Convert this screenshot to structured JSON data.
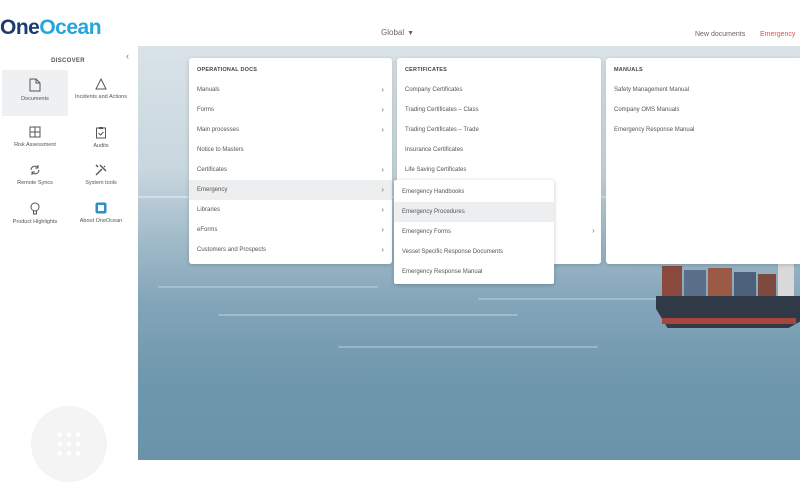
{
  "header": {
    "logo_one": "One",
    "logo_ocean": "Ocean",
    "region_selector": "Global",
    "new_documents": "New documents",
    "emergency": "Emergency"
  },
  "sidebar": {
    "title": "DISCOVER",
    "items": [
      {
        "label": "Documents",
        "icon": "document-icon",
        "active": true
      },
      {
        "label": "Incidents and Actions",
        "icon": "warning-icon"
      },
      {
        "label": "Risk Assessment",
        "icon": "grid-icon"
      },
      {
        "label": "Audits",
        "icon": "clipboard-icon"
      },
      {
        "label": "Remote Syncs",
        "icon": "sync-icon"
      },
      {
        "label": "System tools",
        "icon": "tools-icon"
      },
      {
        "label": "Product Highlights",
        "icon": "lightbulb-icon"
      },
      {
        "label": "About OneOcean",
        "icon": "info-icon"
      }
    ]
  },
  "menus": {
    "operational": {
      "heading": "OPERATIONAL DOCS",
      "items": [
        {
          "label": "Manuals",
          "arrow": true
        },
        {
          "label": "Forms",
          "arrow": true
        },
        {
          "label": "Main processes",
          "arrow": true
        },
        {
          "label": "Notice to Masters",
          "arrow": false
        },
        {
          "label": "Certificates",
          "arrow": true
        },
        {
          "label": "Emergency",
          "arrow": true,
          "highlighted": true
        },
        {
          "label": "Libraries",
          "arrow": true
        },
        {
          "label": "eForms",
          "arrow": true
        },
        {
          "label": "Customers and Prospects",
          "arrow": true
        }
      ]
    },
    "certificates": {
      "heading": "CERTIFICATES",
      "items": [
        {
          "label": "Company Certificates"
        },
        {
          "label": "Trading Certificates – Class"
        },
        {
          "label": "Trading Certificates – Trade"
        },
        {
          "label": "Insurance Certificates"
        },
        {
          "label": "Life Saving Certificates"
        }
      ]
    },
    "manuals": {
      "heading": "MANUALS",
      "items": [
        {
          "label": "Safety Management Manual"
        },
        {
          "label": "Company OMS Manuals"
        },
        {
          "label": "Emergency Response Manual"
        }
      ]
    },
    "emergency_submenu": {
      "items": [
        {
          "label": "Emergency Handbooks"
        },
        {
          "label": "Emergency Procedures",
          "highlighted": true
        },
        {
          "label": "Emergency Forms"
        },
        {
          "label": "Vessel Specific Response Documents"
        },
        {
          "label": "Emergency Response Manual"
        }
      ]
    }
  },
  "colors": {
    "brand_dark": "#1d3b6d",
    "brand_light": "#23a6e0",
    "emergency": "#e35050"
  }
}
